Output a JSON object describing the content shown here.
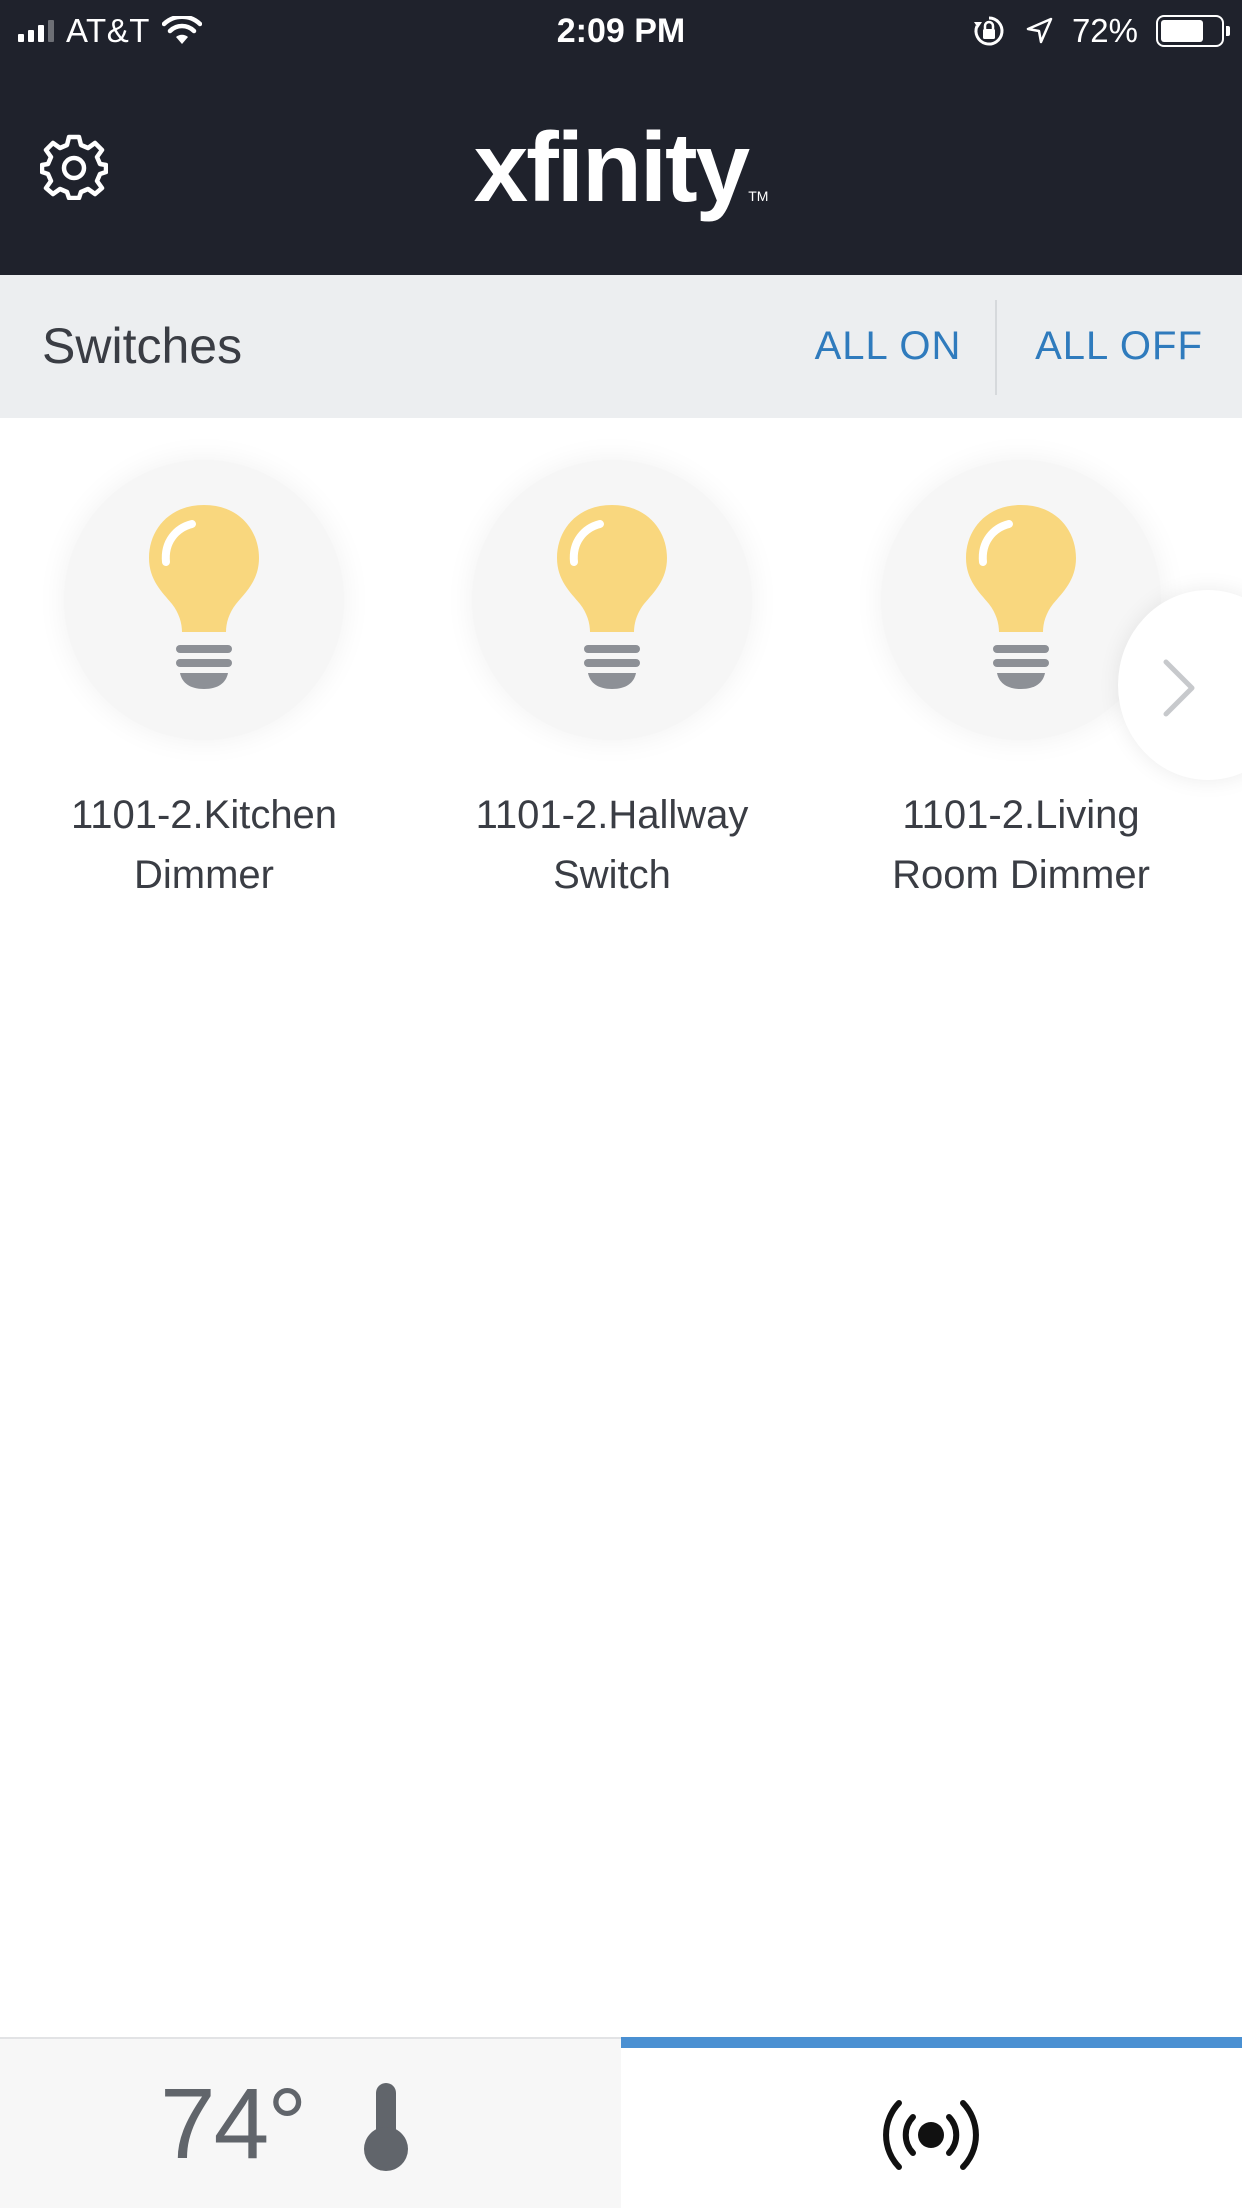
{
  "status_bar": {
    "carrier": "AT&T",
    "time": "2:09 PM",
    "battery_percent": "72%",
    "battery_level": 0.72,
    "icons": [
      "signal-icon",
      "wifi-icon",
      "orientation-lock-icon",
      "location-arrow-icon",
      "battery-icon"
    ]
  },
  "header": {
    "logo_text": "xfinity",
    "logo_tm": "TM",
    "settings_icon": "gear-icon"
  },
  "switches_bar": {
    "title": "Switches",
    "all_on_label": "ALL ON",
    "all_off_label": "ALL OFF"
  },
  "switches": [
    {
      "line1": "1101-2.Kitchen",
      "line2": "Dimmer",
      "icon": "light-bulb-icon",
      "state": "on"
    },
    {
      "line1": "1101-2.Hallway",
      "line2": "Switch",
      "icon": "light-bulb-icon",
      "state": "on"
    },
    {
      "line1": "1101-2.Living",
      "line2": "Room Dimmer",
      "icon": "light-bulb-icon",
      "state": "on"
    }
  ],
  "carousel": {
    "next_icon": "chevron-right-icon"
  },
  "bottom_bar": {
    "temperature": "74°",
    "temperature_icon": "thermometer-icon",
    "devices_icon": "broadcast-icon",
    "active_tab": "devices"
  },
  "colors": {
    "header_bg": "#1f222c",
    "switches_bar_bg": "#eceef0",
    "link_blue": "#2f7bbd",
    "bulb_yellow": "#f9d77e",
    "bulb_base": "#8d9096",
    "tab_indicator": "#4a90d2"
  }
}
